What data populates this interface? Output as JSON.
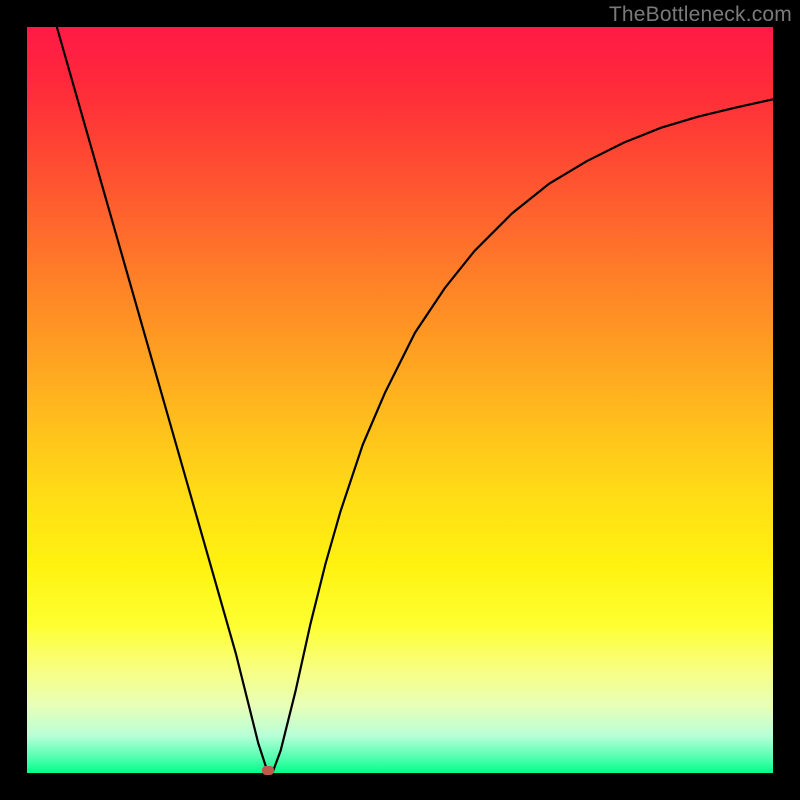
{
  "watermark": "TheBottleneck.com",
  "colors": {
    "frame": "#000000",
    "curve": "#000000",
    "marker": "#c1594b",
    "gradient_top": "#ff1a46",
    "gradient_bottom": "#00ff88"
  },
  "chart_data": {
    "type": "line",
    "title": "",
    "xlabel": "",
    "ylabel": "",
    "xlim": [
      0,
      100
    ],
    "ylim": [
      0,
      100
    ],
    "series": [
      {
        "name": "bottleneck-curve",
        "x": [
          4,
          6,
          8,
          10,
          12,
          14,
          16,
          18,
          20,
          22,
          24,
          26,
          28,
          30,
          31,
          32.3,
          33,
          34,
          36,
          38,
          40,
          42,
          45,
          48,
          52,
          56,
          60,
          65,
          70,
          75,
          80,
          85,
          90,
          95,
          100
        ],
        "values": [
          100,
          93,
          86,
          79,
          72,
          65,
          58,
          51,
          44,
          37,
          30,
          23,
          16,
          8,
          4,
          0,
          0.3,
          3,
          11,
          20,
          28,
          35,
          44,
          51,
          59,
          65,
          70,
          75,
          79,
          82,
          84.5,
          86.5,
          88,
          89.2,
          90.3
        ]
      }
    ],
    "annotations": [
      {
        "name": "optimal-point",
        "x": 32.3,
        "y": 0
      }
    ]
  }
}
